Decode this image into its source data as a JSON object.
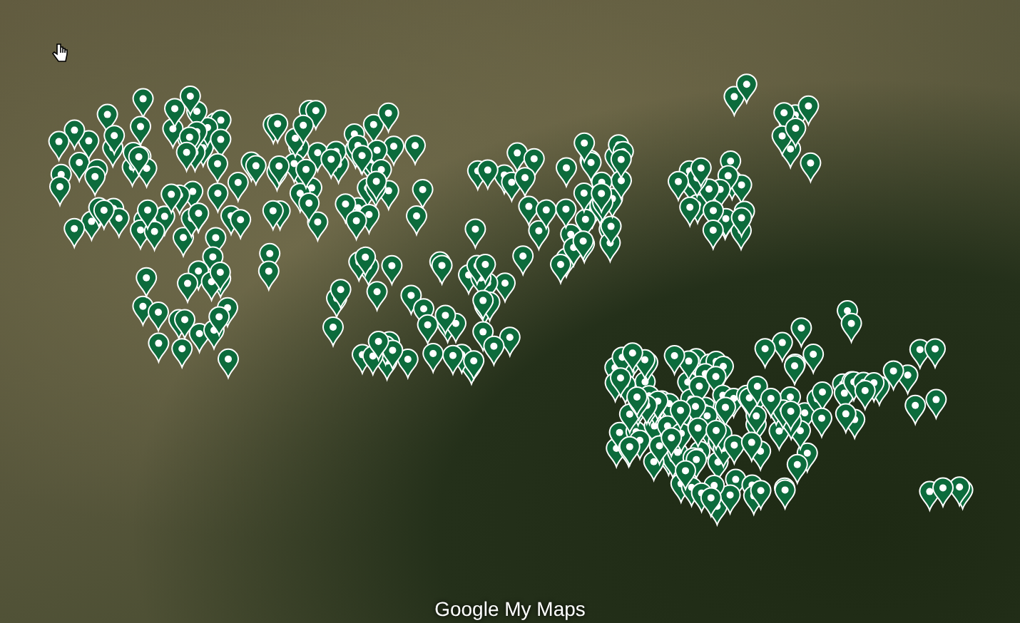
{
  "map": {
    "logo": "Google My Maps"
  }
}
